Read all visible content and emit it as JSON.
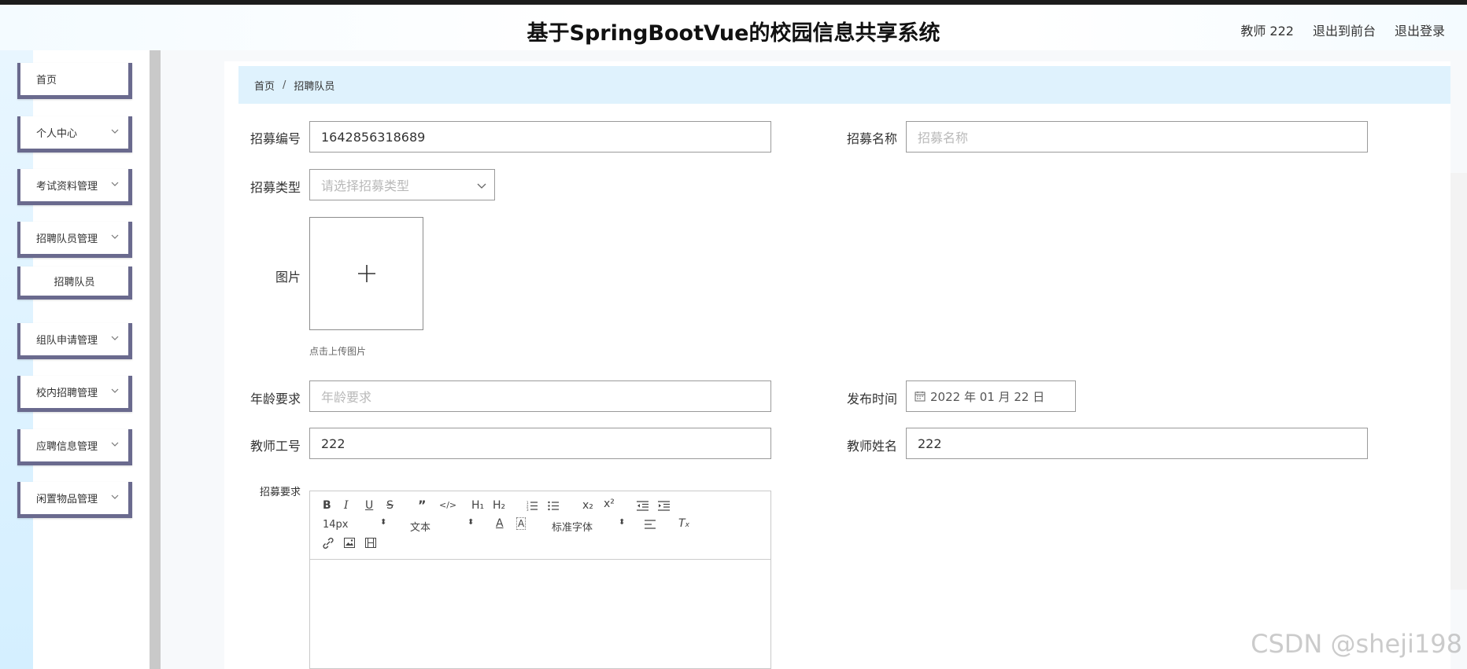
{
  "header": {
    "title": "基于SpringBootVue的校园信息共享系统",
    "user_label": "教师 222",
    "to_front_label": "退出到前台",
    "logout_label": "退出登录"
  },
  "sidebar": {
    "items": [
      {
        "label": "首页"
      },
      {
        "label": "个人中心"
      },
      {
        "label": "考试资料管理"
      },
      {
        "label": "招聘队员管理"
      },
      {
        "label": "招聘队员"
      },
      {
        "label": "组队申请管理"
      },
      {
        "label": "校内招聘管理"
      },
      {
        "label": "应聘信息管理"
      },
      {
        "label": "闲置物品管理"
      }
    ]
  },
  "breadcrumb": {
    "home": "首页",
    "separator": "/",
    "current": "招聘队员"
  },
  "form": {
    "recruit_no_label": "招募编号",
    "recruit_no_value": "1642856318689",
    "recruit_name_label": "招募名称",
    "recruit_name_placeholder": "招募名称",
    "recruit_type_label": "招募类型",
    "recruit_type_placeholder": "请选择招募类型",
    "image_label": "图片",
    "upload_tip": "点击上传图片",
    "age_label": "年龄要求",
    "age_placeholder": "年龄要求",
    "publish_time_label": "发布时间",
    "publish_time_value": "2022 年 01 月 22 日",
    "teacher_no_label": "教师工号",
    "teacher_no_value": "222",
    "teacher_name_label": "教师姓名",
    "teacher_name_value": "222",
    "requirement_label": "招募要求"
  },
  "editor": {
    "font_size": "14px",
    "text_style": "文本",
    "font_family": "标准字体",
    "h1": "H₁",
    "h2": "H₂"
  },
  "watermark": {
    "text": "CSDN @sheji198"
  }
}
